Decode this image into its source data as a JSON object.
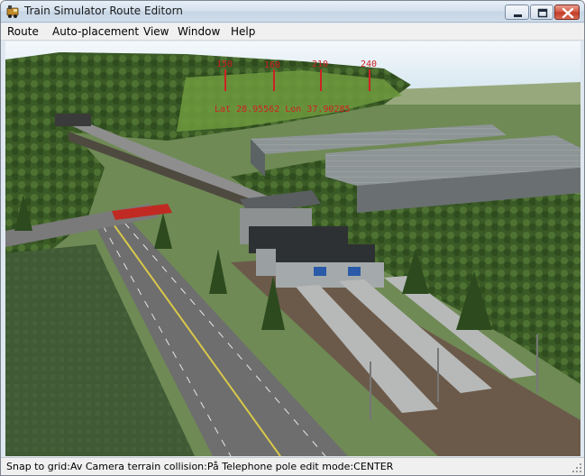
{
  "window": {
    "title": "Train Simulator Route Editorn"
  },
  "menu": {
    "items": [
      {
        "label": "Route"
      },
      {
        "label": "Auto-placement"
      },
      {
        "label": "View"
      },
      {
        "label": "Window"
      },
      {
        "label": "Help"
      }
    ]
  },
  "viewport": {
    "markers": [
      "150",
      "160",
      "210",
      "240"
    ],
    "coords": "Lat 28.95562 Lon 37.90285"
  },
  "status": {
    "text": "Snap to grid:Av Camera terrain collision:På Telephone pole edit mode:CENTER"
  },
  "colors": {
    "marker_red": "#cc2222",
    "title_gradient_top": "#e6eef7",
    "close_button": "#c23a25"
  }
}
